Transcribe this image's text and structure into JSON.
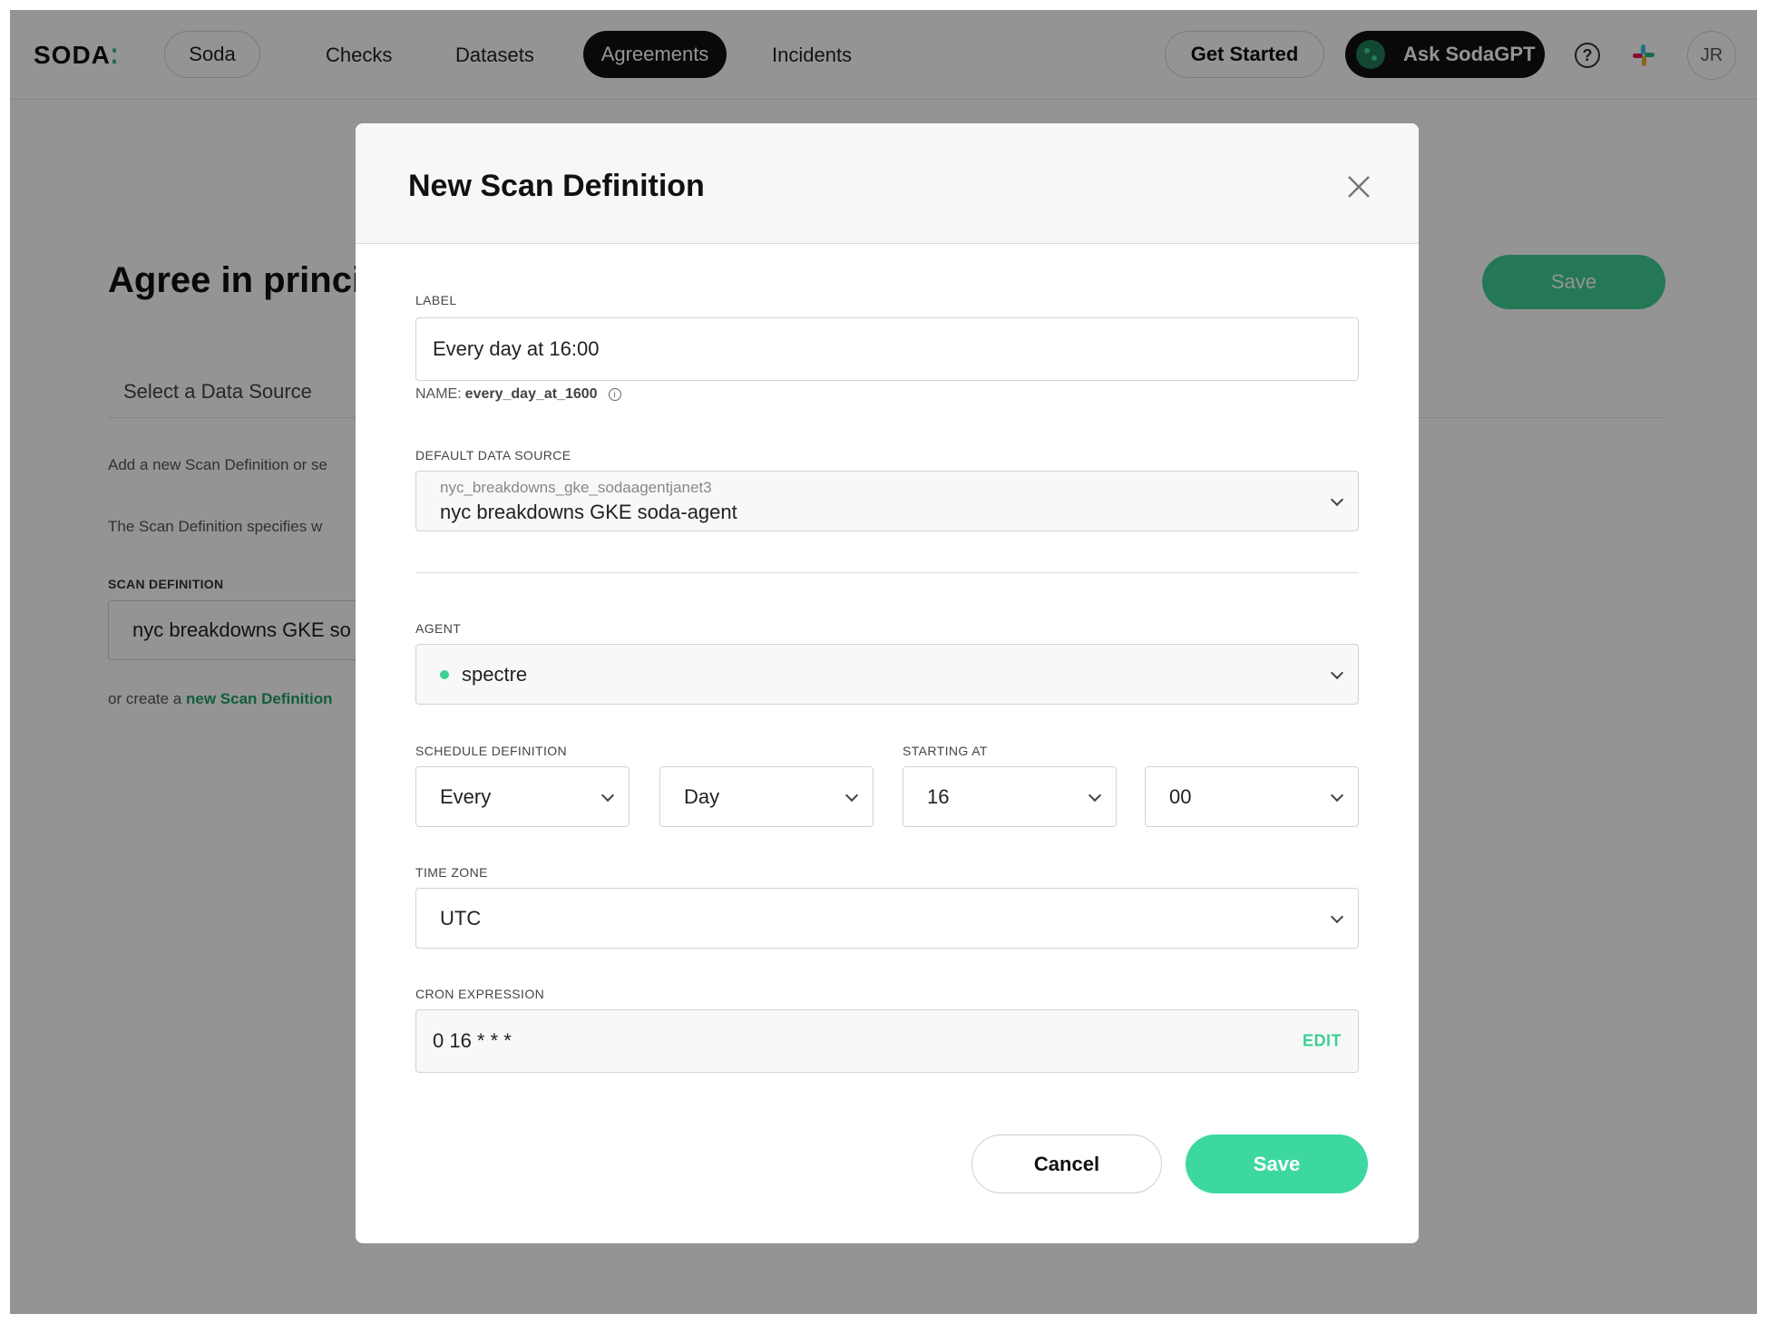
{
  "nav": {
    "logo": "SODA",
    "logo_dots": "⁚",
    "org_pill": "Soda",
    "links": [
      "Checks",
      "Datasets",
      "Agreements",
      "Incidents"
    ],
    "get_started": "Get Started",
    "ask_gpt": "Ask SodaGPT",
    "help": "?",
    "avatar": "JR",
    "active_link": "Agreements"
  },
  "background": {
    "title": "Agree in princi",
    "save": "Save",
    "tab": "Select a Data Source",
    "text1": "Add a new Scan Definition or se",
    "text2": "The Scan Definition specifies w",
    "scan_label": "SCAN DEFINITION",
    "scan_value": "nyc breakdowns GKE so",
    "create_prefix": "or create a ",
    "create_link": "new Scan Definition"
  },
  "modal": {
    "title": "New Scan Definition",
    "label_label": "LABEL",
    "label_value": "Every day at 16:00",
    "name_prefix": "NAME:",
    "name_value": "every_day_at_1600",
    "ds_label": "DEFAULT DATA SOURCE",
    "ds_id": "nyc_breakdowns_gke_sodaagentjanet3",
    "ds_name": "nyc breakdowns GKE soda-agent",
    "agent_label": "AGENT",
    "agent_value": "spectre",
    "schedule_label": "SCHEDULE DEFINITION",
    "schedule_every": "Every",
    "schedule_unit": "Day",
    "starting_label": "STARTING AT",
    "start_hour": "16",
    "start_minute": "00",
    "tz_label": "TIME ZONE",
    "tz_value": "UTC",
    "cron_label": "CRON EXPRESSION",
    "cron_value": "0 16 * * *",
    "edit": "EDIT",
    "cancel": "Cancel",
    "save": "Save"
  },
  "colors": {
    "accent": "#3dd8a0",
    "dark": "#111111"
  }
}
